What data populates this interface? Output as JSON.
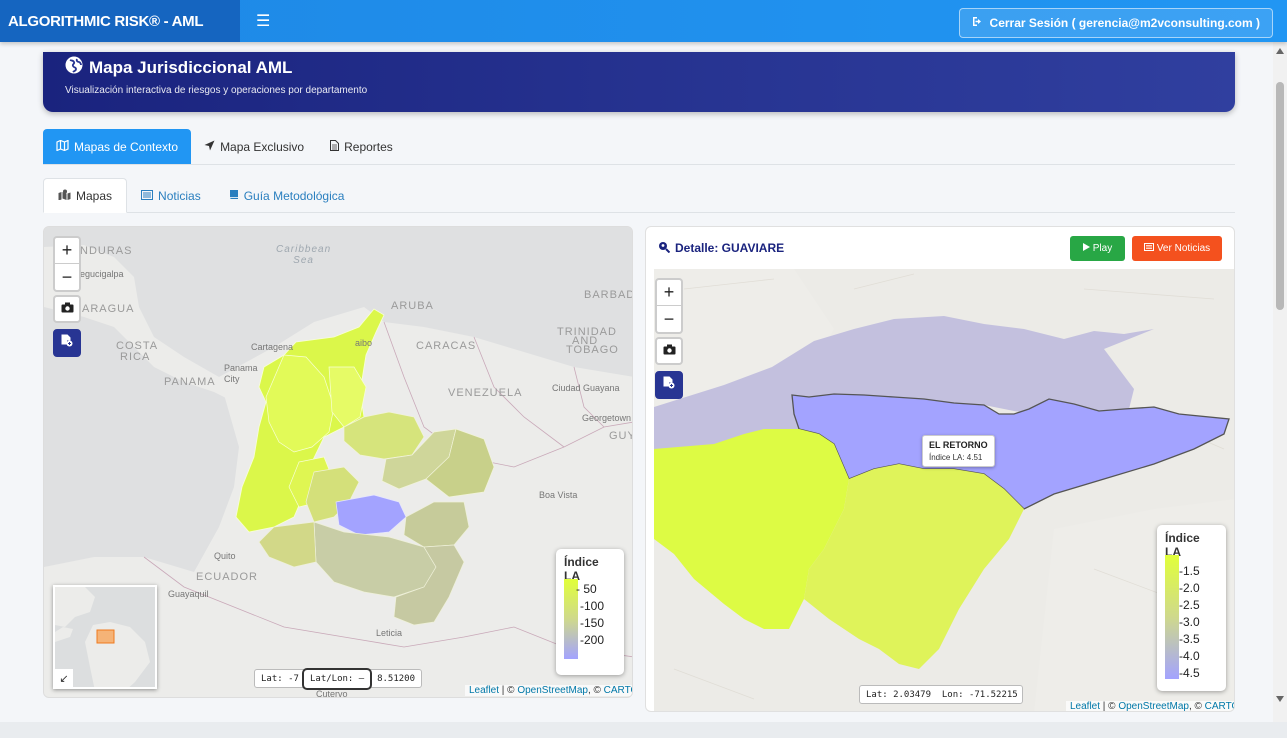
{
  "navbar": {
    "brand": "ALGORITHMIC RISK® - AML",
    "logout_label": "Cerrar Sesión ( gerencia@m2vconsulting.com )"
  },
  "banner": {
    "title": "Mapa Jurisdiccional AML",
    "subtitle": "Visualización interactiva de riesgos y operaciones por departamento"
  },
  "tabs_primary": [
    {
      "label": "Mapas de Contexto",
      "icon": "map-icon",
      "active": true
    },
    {
      "label": "Mapa Exclusivo",
      "icon": "location-arrow-icon",
      "active": false
    },
    {
      "label": "Reportes",
      "icon": "file-icon",
      "active": false
    }
  ],
  "tabs_secondary": [
    {
      "label": "Mapas",
      "icon": "map-marked-icon",
      "active": true
    },
    {
      "label": "Noticias",
      "icon": "newspaper-icon",
      "active": false
    },
    {
      "label": "Guía Metodológica",
      "icon": "book-icon",
      "active": false
    }
  ],
  "left_map": {
    "labels": {
      "caribbean": "Caribbean",
      "sea": "Sea",
      "honduras": "NDURAS",
      "tegucigalpa": "egucigalpa",
      "nicaragua": "ARAGUA",
      "costa": "COSTA",
      "rica": "RICA",
      "panama_country": "PANAMA",
      "panama_city": "Panama",
      "city": "City",
      "aruba": "ARUBA",
      "barbado": "BARBADO",
      "cartagena": "Cartagena",
      "maracaibo": "aibo",
      "caracas": "CARACAS",
      "trinidad": "TRINIDAD",
      "and": "AND",
      "tobago": "TOBAGO",
      "venezuela": "VENEZUELA",
      "ciudad_guayana": "Ciudad Guayana",
      "georgetown": "Georgetown",
      "guyana": "GUY",
      "boa_vista": "Boa Vista",
      "quito": "Quito",
      "ecuador": "ECUADOR",
      "guayaquil": "Guayaquil",
      "leticia": "Leticia",
      "cutervo": "Cutervo"
    },
    "legend": {
      "title": "Índice LA",
      "ticks": [
        "- 50",
        "-100",
        "-150",
        "-200"
      ]
    },
    "coord_lat": "Lat: -7",
    "coord_popup": "Lat/Lon: —",
    "coord_tail": "8.51200",
    "attribution": {
      "leaflet": "Leaflet",
      "sep1": " | © ",
      "osm": "OpenStreetMap",
      "sep2": ", © ",
      "carto": "CARTO"
    }
  },
  "right_panel": {
    "title": "Detalle: GUAVIARE",
    "play_label": "Play",
    "news_label": "Ver Noticias",
    "tooltip": {
      "name": "EL RETORNO",
      "value": "Índice LA: 4.51"
    },
    "legend": {
      "title": "Índice LA",
      "ticks": [
        "-1.5",
        "-2.0",
        "-2.5",
        "-3.0",
        "-3.5",
        "-4.0",
        "-4.5"
      ]
    },
    "coord": "Lat: 2.03479  Lon: -71.52215",
    "attribution": {
      "leaflet": "Leaflet",
      "sep1": " | © ",
      "osm": "OpenStreetMap",
      "sep2": ", © ",
      "carto": "CARTO"
    }
  },
  "colors": {
    "navbar": "#2196f3",
    "banner": "#283593",
    "tab_active": "#2196f3",
    "play": "#28a745",
    "news": "#f4511e",
    "choropleth_high": "#e1ff3a",
    "choropleth_mid": "#c8d08a",
    "choropleth_low": "#a3a3ff"
  }
}
